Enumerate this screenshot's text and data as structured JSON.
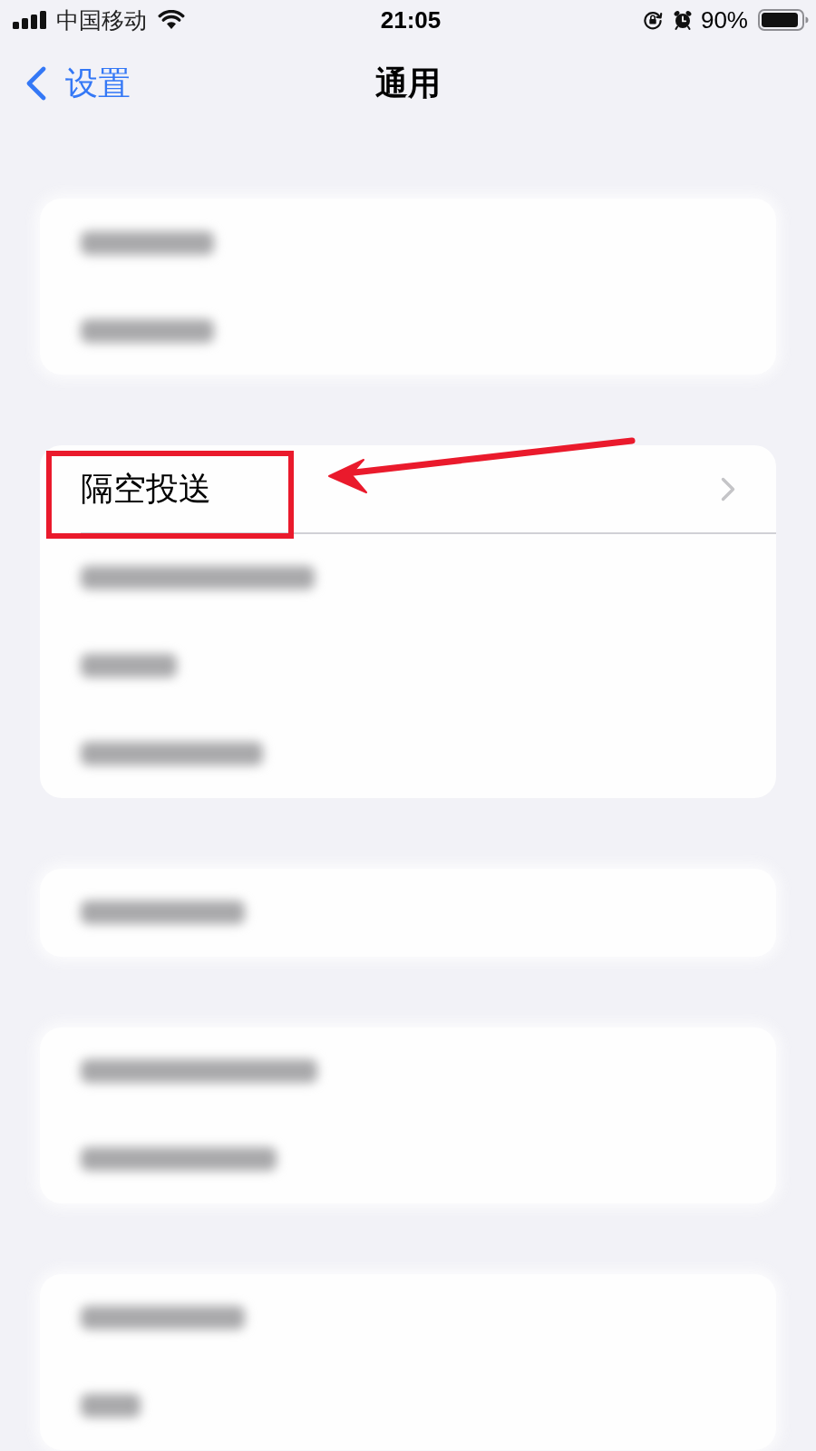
{
  "status_bar": {
    "carrier": "中国移动",
    "time": "21:05",
    "battery": "90%"
  },
  "nav": {
    "back_label": "设置",
    "title": "通用"
  },
  "sections": [
    {
      "rows": [
        {
          "kind": "blurred"
        },
        {
          "kind": "blurred"
        }
      ]
    },
    {
      "rows": [
        {
          "kind": "item",
          "label": "隔空投送",
          "annotated": true
        },
        {
          "kind": "blurred"
        },
        {
          "kind": "blurred"
        },
        {
          "kind": "blurred"
        }
      ]
    },
    {
      "rows": [
        {
          "kind": "blurred"
        }
      ]
    },
    {
      "rows": [
        {
          "kind": "blurred"
        },
        {
          "kind": "blurred"
        }
      ]
    },
    {
      "rows": [
        {
          "kind": "blurred"
        },
        {
          "kind": "blurred"
        }
      ]
    }
  ]
}
